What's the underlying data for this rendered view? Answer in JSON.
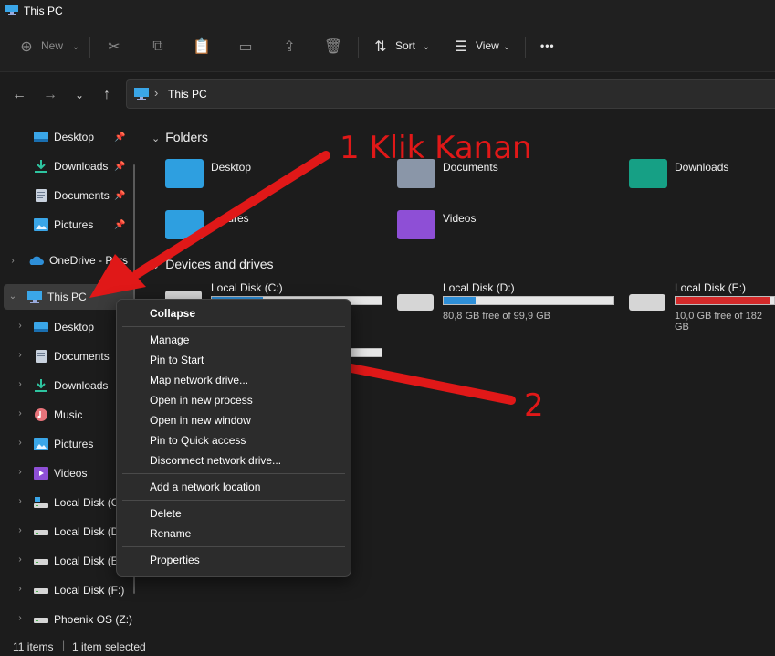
{
  "window": {
    "title": "This PC"
  },
  "toolbar": {
    "new_label": "New",
    "sort_label": "Sort",
    "view_label": "View",
    "more_label": "•••"
  },
  "address": {
    "path": "This PC",
    "separator": "›"
  },
  "sidebar": {
    "quick_access": [
      {
        "label": "Desktop",
        "icon": "desktop-icon",
        "pinned": true
      },
      {
        "label": "Downloads",
        "icon": "downloads-icon",
        "pinned": true
      },
      {
        "label": "Documents",
        "icon": "documents-icon",
        "pinned": true
      },
      {
        "label": "Pictures",
        "icon": "pictures-icon",
        "pinned": true
      }
    ],
    "onedrive": "OneDrive - Pers",
    "this_pc": "This PC",
    "this_pc_children": [
      {
        "label": "Desktop",
        "icon": "desktop-icon"
      },
      {
        "label": "Documents",
        "icon": "documents-icon"
      },
      {
        "label": "Downloads",
        "icon": "downloads-icon"
      },
      {
        "label": "Music",
        "icon": "music-icon"
      },
      {
        "label": "Pictures",
        "icon": "pictures-icon"
      },
      {
        "label": "Videos",
        "icon": "videos-icon"
      },
      {
        "label": "Local Disk (C",
        "icon": "drive-icon"
      },
      {
        "label": "Local Disk (D",
        "icon": "drive-icon"
      },
      {
        "label": "Local Disk (E",
        "icon": "drive-icon"
      },
      {
        "label": "Local Disk (F:)",
        "icon": "drive-icon"
      },
      {
        "label": "Phoenix OS (Z:)",
        "icon": "drive-icon"
      }
    ]
  },
  "content": {
    "folders_header": "Folders",
    "folders": [
      {
        "label": "Desktop",
        "color": "#2e9fe0"
      },
      {
        "label": "Documents",
        "color": "#8a96a8"
      },
      {
        "label": "Downloads",
        "color": "#16a085"
      },
      {
        "label": "ctures",
        "color": "#2e9fe0"
      },
      {
        "label": "Videos",
        "color": "#8e4fd6"
      }
    ],
    "drives_header": "Devices and drives",
    "drives": [
      {
        "label": "Local Disk (C:)",
        "free": "",
        "used_fraction": 0.3,
        "bar_color": "#2e8fd8"
      },
      {
        "label": "Local Disk (D:)",
        "free": "80,8 GB free of 99,9 GB",
        "used_fraction": 0.19,
        "bar_color": "#2e8fd8"
      },
      {
        "label": "Local Disk (E:)",
        "free": "10,0 GB free of 182 GB",
        "used_fraction": 0.95,
        "bar_color": "#d42a2a"
      }
    ]
  },
  "context_menu": {
    "collapse": "Collapse",
    "manage": "Manage",
    "pin_start": "Pin to Start",
    "map_drive": "Map network drive...",
    "open_process": "Open in new process",
    "open_window": "Open in new window",
    "pin_quick": "Pin to Quick access",
    "disconnect": "Disconnect network drive...",
    "add_location": "Add a network location",
    "delete": "Delete",
    "rename": "Rename",
    "properties": "Properties"
  },
  "annotations": {
    "step1": "1 Klik Kanan",
    "step2": "2",
    "color": "#e01818"
  },
  "status": {
    "items": "11 items",
    "selected": "1 item selected"
  }
}
